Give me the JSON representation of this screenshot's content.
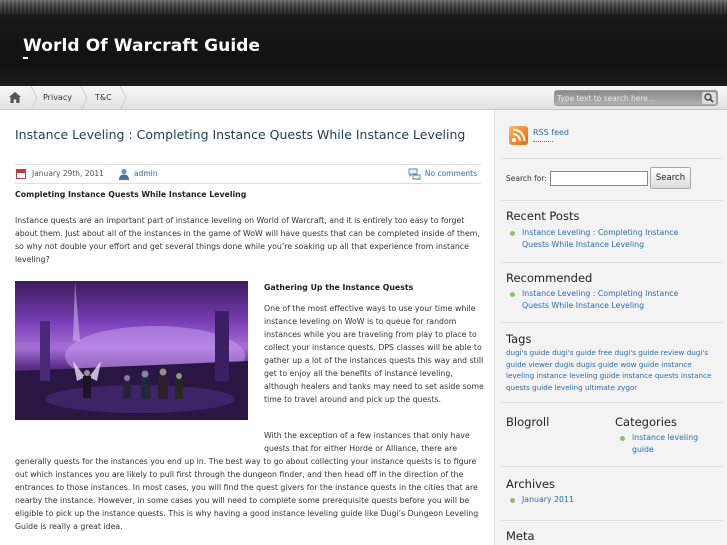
{
  "site": {
    "title": "World Of Warcraft Guide"
  },
  "nav": {
    "items": [
      "Privacy",
      "T&C"
    ],
    "search_placeholder": "Type text to search here..."
  },
  "post": {
    "title": "Instance Leveling : Completing Instance Quests While Instance Leveling",
    "date": "January 29th, 2011",
    "author": "admin",
    "comments": "No comments",
    "subtitle": "Completing Instance Quests While Instance Leveling",
    "intro": "Instance quests are an important part of instance leveling on World of Warcraft, and it is entirely too easy to forget about them. Just about all of the instances in the game of WoW will have quests that can be completed inside of them, so why not double your effort and get several things done while you’re soaking up all that experience from instance leveling?",
    "section_heading": "Gathering Up the Instance Quests",
    "para1": "One of the most effective ways to use your time while instance leveling on WoW is to queue for random instances while you are traveling from play to place to collect your instance quests. DPS classes will be able to gather up a lot of the instances quests this way and still get to enjoy all the benefits of instance leveling, although healers and tanks may need to set aside some time to travel around and pick up the quests.",
    "para2_top": "With the exception of a few instances that only have quests that for either Horde or Alliance, there are",
    "para2_rest": "generally quests for the instances you end up in. The best way to go about collecting your instance quests is to figure out which instances you are likely to pull first through the dungeon finder, and then head off in the direction of the entrances to those instances. In most cases, you will find the quest givers for the instance quests in the cities that are nearby the instance. However, in some cases you will need to complete some prerequisite quests before you will be eligible to pick up the instance quests. This is why having a good instance leveling guide like Dugi’s Dungeon Leveling Guide is really a great idea."
  },
  "sidebar": {
    "rss": "RSS feed",
    "search_label": "Search for:",
    "search_button": "Search",
    "recent_posts": {
      "title": "Recent Posts",
      "items": [
        "Instance Leveling : Completing Instance Quests While Instance Leveling"
      ]
    },
    "recommended": {
      "title": "Recommended",
      "items": [
        "Instance Leveling : Completing Instance Quests While Instance Leveling"
      ]
    },
    "tags": {
      "title": "Tags",
      "text": "dugi's guide dugi's guide free dugi's guide review dugi's guide viewer dugis dugis guide wow guide instance leveling instance leveling guide instance quests instance quests guide leveling ultimate zygor"
    },
    "blogroll": {
      "title": "Blogroll"
    },
    "categories": {
      "title": "Categories",
      "items": [
        "instance leveling guide"
      ]
    },
    "archives": {
      "title": "Archives",
      "items": [
        "January 2011"
      ]
    },
    "meta": {
      "title": "Meta"
    }
  }
}
